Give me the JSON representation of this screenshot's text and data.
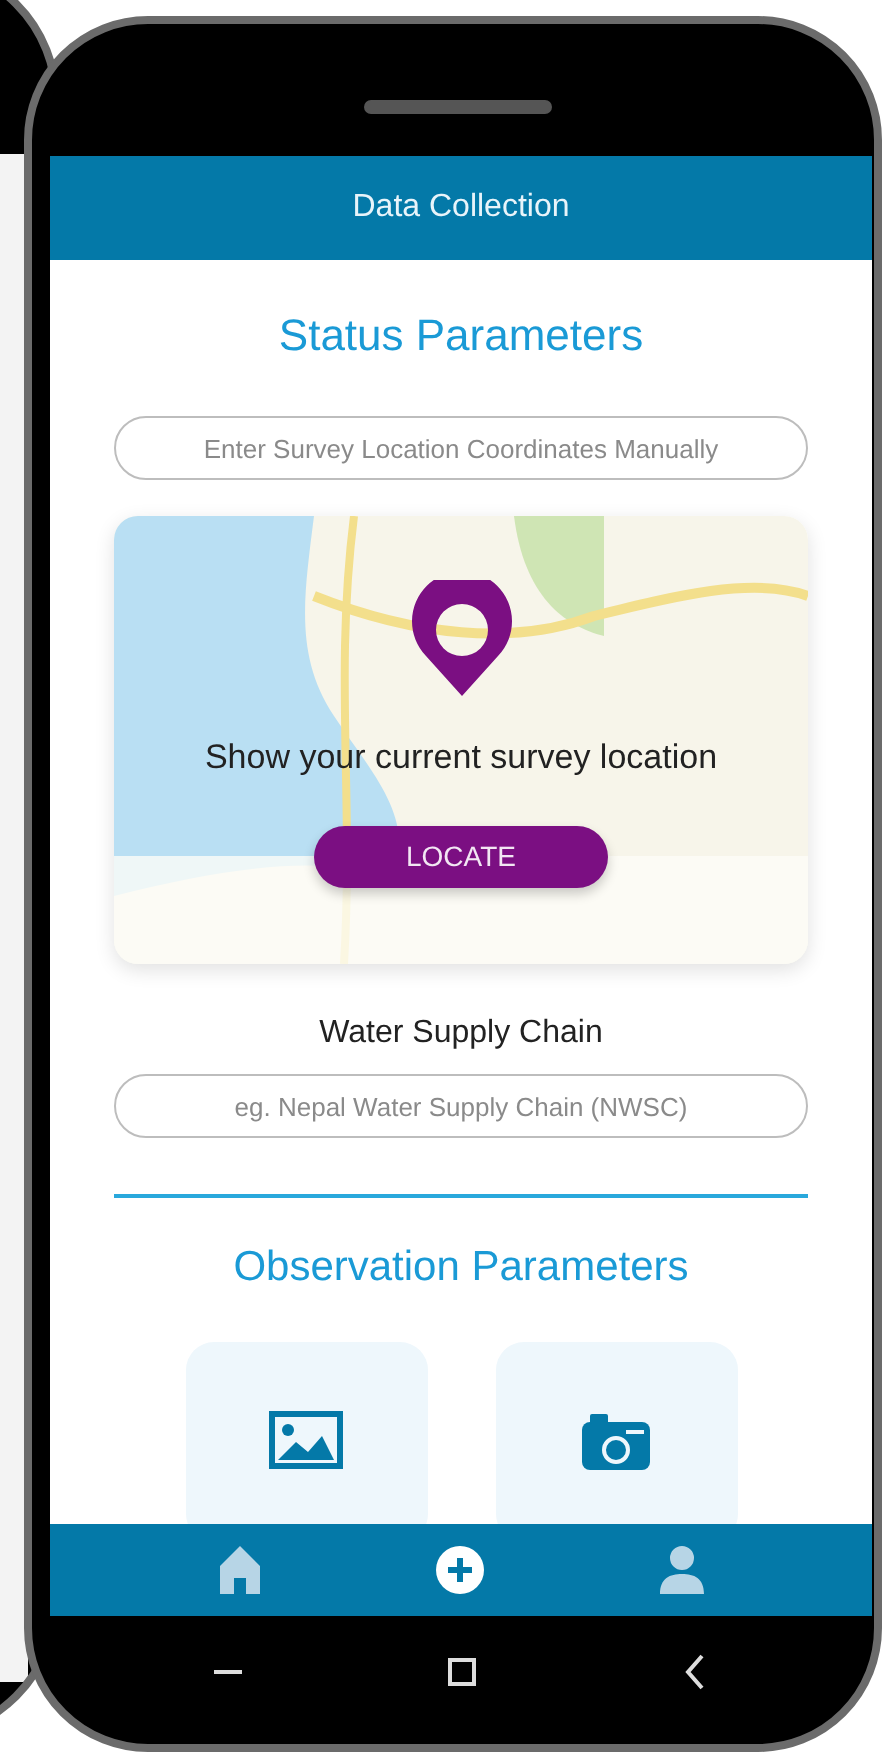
{
  "header": {
    "title": "Data Collection"
  },
  "status_section": {
    "heading": "Status Parameters",
    "coordinates_field": {
      "placeholder": "Enter Survey Location Coordinates Manually"
    },
    "map_card": {
      "message": "Show your current survey location",
      "button": "LOCATE"
    },
    "supply_chain": {
      "label": "Water Supply Chain",
      "placeholder": "eg. Nepal Water Supply Chain (NWSC)"
    }
  },
  "observation_section": {
    "heading": "Observation Parameters",
    "tiles": [
      {
        "kind": "image"
      },
      {
        "kind": "camera"
      }
    ]
  },
  "bottom_nav": [
    {
      "kind": "home",
      "selected": false
    },
    {
      "kind": "add",
      "selected": true
    },
    {
      "kind": "profile",
      "selected": false
    }
  ],
  "system_nav": [
    {
      "kind": "recents"
    },
    {
      "kind": "home"
    },
    {
      "kind": "back"
    }
  ]
}
